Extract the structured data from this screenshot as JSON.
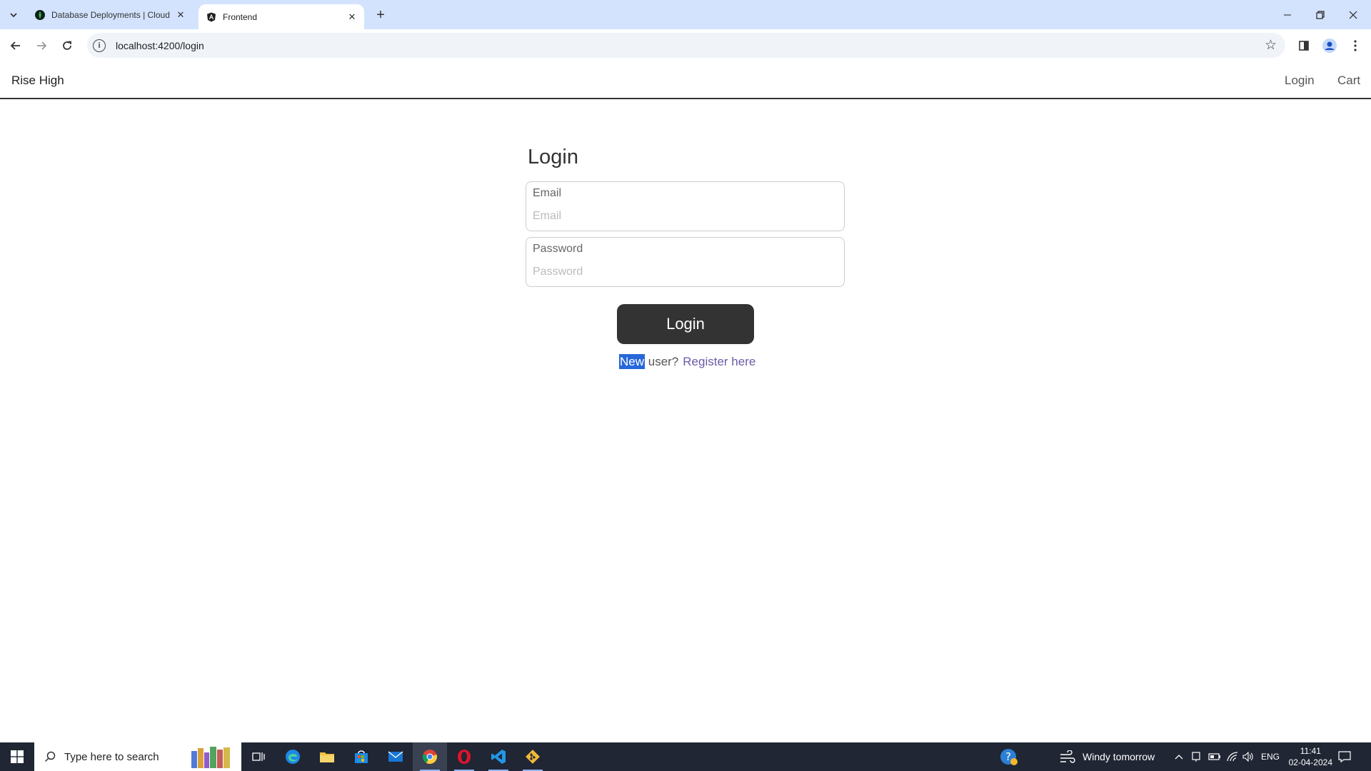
{
  "browser": {
    "tabs": [
      {
        "title": "Database Deployments | Cloud",
        "active": false
      },
      {
        "title": "Frontend",
        "active": true
      }
    ],
    "url": "localhost:4200/login"
  },
  "navbar": {
    "brand": "Rise High",
    "links": [
      "Login",
      "Cart"
    ]
  },
  "login_form": {
    "title": "Login",
    "email": {
      "label": "Email",
      "placeholder": "Email",
      "value": ""
    },
    "password": {
      "label": "Password",
      "placeholder": "Password",
      "value": ""
    },
    "submit_label": "Login",
    "register_prompt_selected": "New",
    "register_prompt_rest": " user?",
    "register_link": "Register here"
  },
  "taskbar": {
    "search_placeholder": "Type here to search",
    "weather": "Windy tomorrow",
    "language": "ENG",
    "time": "11:41",
    "date": "02-04-2024"
  },
  "colors": {
    "tabstrip": "#d3e3fd",
    "button_bg": "#333333",
    "link": "#6c5ba8",
    "selection": "#2767d9",
    "taskbar": "#202634"
  }
}
